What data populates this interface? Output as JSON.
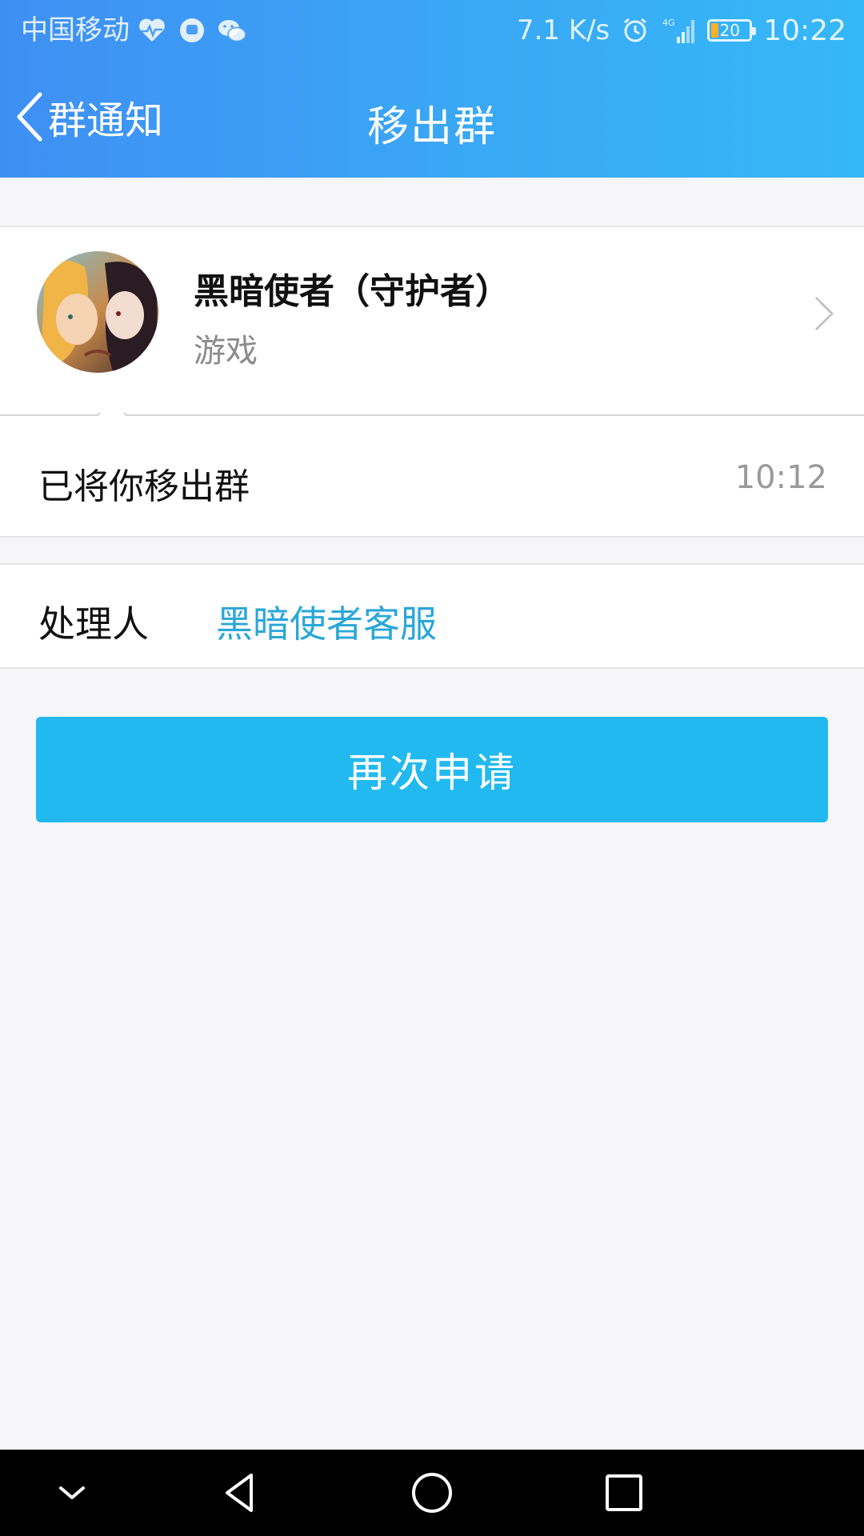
{
  "status_bar": {
    "carrier": "中国移动",
    "net_speed": "7.1 K/s",
    "network": "4G",
    "battery_level": "20",
    "time": "10:22",
    "icons": [
      "heart-pulse-icon",
      "chat-bubble-icon",
      "wechat-icon",
      "alarm-icon",
      "signal-icon",
      "battery-icon"
    ]
  },
  "nav": {
    "back_label": "群通知",
    "title": "移出群"
  },
  "group": {
    "name": "黑暗使者（守护者）",
    "category": "游戏"
  },
  "notification": {
    "message": "已将你移出群",
    "time": "10:12"
  },
  "handler": {
    "label": "处理人",
    "name": "黑暗使者客服"
  },
  "actions": {
    "reapply_label": "再次申请"
  },
  "colors": {
    "header_start": "#3f8ff3",
    "header_end": "#35b8f6",
    "button": "#22b9f0",
    "link": "#2aa7d8"
  }
}
